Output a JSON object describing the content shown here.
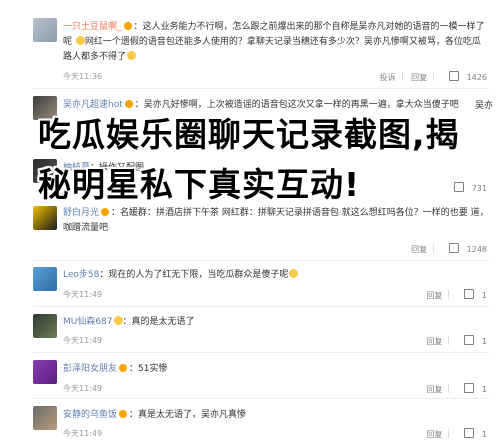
{
  "comments": [
    {
      "username": "一只土豆鼠啊_",
      "text": "：这人业务能力不行啊，怎么跟之前爆出来的那个自称是吴亦凡对她的语音的一模一样了呢",
      "text2": "网红一个遗假的语音包还能多人使用的？拿聊天记录当穗还有多少次？吴亦凡惨啊又被骂，各位吃瓜路人都多不得了",
      "time": "今天11:36",
      "actions": [
        "投诉",
        "回复",
        "1426"
      ]
    },
    {
      "username": "吴亦凡超速hot",
      "text": "：吴亦凡好惨啊，上次被造谣的语音包这次又拿一样的再黑一遍，拿大众当傻子吧",
      "text2": "",
      "time": "",
      "actions": [
        "吴亦"
      ]
    },
    {
      "username": "柚枝蔓",
      "text": "：操作又配图",
      "text2": "",
      "time": "",
      "actions": [
        "731"
      ]
    },
    {
      "username": "舒白月光",
      "text": "：名媛群：拼酒店拼下午茶 网红群：拼聊天记录拼语音包 就这么想红吗各位？一样的也要",
      "text2": "道，咖蹭流量吧",
      "time": "今天11:36",
      "actions": [
        "回复",
        "1248"
      ]
    },
    {
      "username": "Leo步58",
      "text": "：现在的人为了红无下限，当吃瓜群众是傻子呢",
      "text2": "",
      "time": "今天11:49",
      "actions": [
        "回复",
        "1"
      ]
    },
    {
      "username": "MU仙森687",
      "text": "：真的是太无语了",
      "text2": "",
      "time": "今天11:49",
      "actions": [
        "回复",
        "1"
      ]
    },
    {
      "username": "彭泽阳女朋友",
      "text": "：51实惨",
      "text2": "",
      "time": "今天11:49",
      "actions": [
        "回复",
        "1"
      ]
    },
    {
      "username": "安静的乌鱼饭",
      "text": "：真是太无语了，吴亦凡真惨",
      "text2": "",
      "time": "今天11:49",
      "actions": [
        "回复",
        "1"
      ]
    }
  ],
  "overlay_title": "吃瓜娱乐圈聊天记录截图,揭秘明星私下真实互动!"
}
